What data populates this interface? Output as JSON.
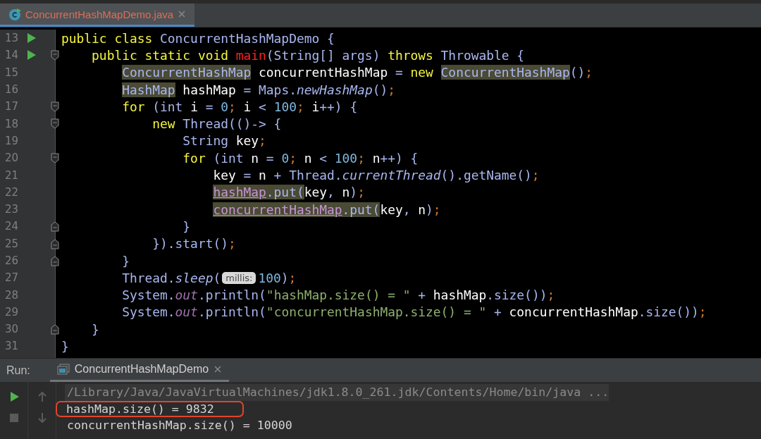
{
  "editor_tab": {
    "label": "ConcurrentHashMapDemo.java",
    "selected": true
  },
  "code_lines": [
    {
      "number": "13",
      "run": true,
      "fold_start": false,
      "fold_end": false,
      "tokens": [
        {
          "text": "public class ",
          "kind": "kw"
        },
        {
          "text": "ConcurrentHashMapDemo {",
          "kind": "sym"
        }
      ]
    },
    {
      "number": "14",
      "run": true,
      "fold_start": true,
      "fold_end": false,
      "tokens": [
        {
          "text": "    public static void ",
          "kind": "kw"
        },
        {
          "text": "main",
          "kind": "decl"
        },
        {
          "text": "(String[] args) ",
          "kind": "sym"
        },
        {
          "text": "throws ",
          "kind": "kw"
        },
        {
          "text": "Throwable {",
          "kind": "sym"
        }
      ]
    },
    {
      "number": "15",
      "run": false,
      "fold_start": false,
      "fold_end": false,
      "tokens": [
        {
          "text": "        ConcurrentHashMap",
          "kind": "hl"
        },
        {
          "text": " concurrentHashMap ",
          "kind": "plain"
        },
        {
          "text": "= ",
          "kind": "sym"
        },
        {
          "text": "new ",
          "kind": "kw"
        },
        {
          "text": "ConcurrentHashMap",
          "kind": "hl"
        },
        {
          "text": "()",
          "kind": "sym"
        },
        {
          "text": ";",
          "kind": "semi"
        }
      ]
    },
    {
      "number": "16",
      "run": false,
      "fold_start": false,
      "fold_end": false,
      "tokens": [
        {
          "text": "        HashMap",
          "kind": "hl"
        },
        {
          "text": " hashMap ",
          "kind": "plain"
        },
        {
          "text": "= Maps.",
          "kind": "sym"
        },
        {
          "text": "newHashMap",
          "kind": "italic"
        },
        {
          "text": "()",
          "kind": "sym"
        },
        {
          "text": ";",
          "kind": "semi"
        }
      ]
    },
    {
      "number": "17",
      "run": false,
      "fold_start": true,
      "fold_end": false,
      "tokens": [
        {
          "text": "        for ",
          "kind": "kw"
        },
        {
          "text": "(int ",
          "kind": "sym"
        },
        {
          "text": "i ",
          "kind": "plain"
        },
        {
          "text": "= ",
          "kind": "sym"
        },
        {
          "text": "0",
          "kind": "num"
        },
        {
          "text": ";",
          "kind": "semi"
        },
        {
          "text": " i ",
          "kind": "plain"
        },
        {
          "text": "< ",
          "kind": "sym"
        },
        {
          "text": "100",
          "kind": "num"
        },
        {
          "text": ";",
          "kind": "semi"
        },
        {
          "text": " i",
          "kind": "plain"
        },
        {
          "text": "++) {",
          "kind": "sym"
        }
      ]
    },
    {
      "number": "18",
      "run": false,
      "fold_start": true,
      "fold_end": false,
      "tokens": [
        {
          "text": "            new ",
          "kind": "kw"
        },
        {
          "text": "Thread(()-> {",
          "kind": "sym"
        }
      ]
    },
    {
      "number": "19",
      "run": false,
      "fold_start": false,
      "fold_end": false,
      "tokens": [
        {
          "text": "                String ",
          "kind": "sym"
        },
        {
          "text": "key",
          "kind": "plain"
        },
        {
          "text": ";",
          "kind": "semi"
        }
      ]
    },
    {
      "number": "20",
      "run": false,
      "fold_start": true,
      "fold_end": false,
      "tokens": [
        {
          "text": "                for ",
          "kind": "kw"
        },
        {
          "text": "(int ",
          "kind": "sym"
        },
        {
          "text": "n ",
          "kind": "plain"
        },
        {
          "text": "= ",
          "kind": "sym"
        },
        {
          "text": "0",
          "kind": "num"
        },
        {
          "text": ";",
          "kind": "semi"
        },
        {
          "text": " n ",
          "kind": "plain"
        },
        {
          "text": "< ",
          "kind": "sym"
        },
        {
          "text": "100",
          "kind": "num"
        },
        {
          "text": ";",
          "kind": "semi"
        },
        {
          "text": " n",
          "kind": "plain"
        },
        {
          "text": "++) {",
          "kind": "sym"
        }
      ]
    },
    {
      "number": "21",
      "run": false,
      "fold_start": false,
      "fold_end": false,
      "tokens": [
        {
          "text": "                    key ",
          "kind": "plain"
        },
        {
          "text": "= ",
          "kind": "sym"
        },
        {
          "text": "n ",
          "kind": "plain"
        },
        {
          "text": "+ Thread.",
          "kind": "sym"
        },
        {
          "text": "currentThread",
          "kind": "italic"
        },
        {
          "text": "().getName()",
          "kind": "sym"
        },
        {
          "text": ";",
          "kind": "semi"
        }
      ]
    },
    {
      "number": "22",
      "run": false,
      "fold_start": false,
      "fold_end": false,
      "tokens": [
        {
          "text": "                    hashMap",
          "kind": "field"
        },
        {
          "text": ".put(",
          "kind": "hlsym"
        },
        {
          "text": "key",
          "kind": "plain"
        },
        {
          "text": ", ",
          "kind": "sym"
        },
        {
          "text": "n",
          "kind": "plain"
        },
        {
          "text": ")",
          "kind": "sym"
        },
        {
          "text": ";",
          "kind": "semi"
        }
      ]
    },
    {
      "number": "23",
      "run": false,
      "fold_start": false,
      "fold_end": false,
      "tokens": [
        {
          "text": "                    concurrentHashMap",
          "kind": "field"
        },
        {
          "text": ".put(",
          "kind": "hlsym"
        },
        {
          "text": "key",
          "kind": "plain"
        },
        {
          "text": ", ",
          "kind": "sym"
        },
        {
          "text": "n",
          "kind": "plain"
        },
        {
          "text": ")",
          "kind": "sym"
        },
        {
          "text": ";",
          "kind": "semi"
        }
      ]
    },
    {
      "number": "24",
      "run": false,
      "fold_start": false,
      "fold_end": true,
      "tokens": [
        {
          "text": "                }",
          "kind": "sym"
        }
      ]
    },
    {
      "number": "25",
      "run": false,
      "fold_start": false,
      "fold_end": true,
      "tokens": [
        {
          "text": "            }).start()",
          "kind": "sym"
        },
        {
          "text": ";",
          "kind": "semi"
        }
      ]
    },
    {
      "number": "26",
      "run": false,
      "fold_start": false,
      "fold_end": true,
      "tokens": [
        {
          "text": "        }",
          "kind": "sym"
        }
      ]
    },
    {
      "number": "27",
      "run": false,
      "fold_start": false,
      "fold_end": false,
      "tokens": [
        {
          "text": "        Thread.",
          "kind": "sym"
        },
        {
          "text": "sleep",
          "kind": "italic"
        },
        {
          "text": "(",
          "kind": "sym"
        },
        {
          "text": "millis:",
          "kind": "hint"
        },
        {
          "text": "100",
          "kind": "num"
        },
        {
          "text": ")",
          "kind": "sym"
        },
        {
          "text": ";",
          "kind": "semi"
        }
      ]
    },
    {
      "number": "28",
      "run": false,
      "fold_start": false,
      "fold_end": false,
      "tokens": [
        {
          "text": "        System.",
          "kind": "sym"
        },
        {
          "text": "out",
          "kind": "static"
        },
        {
          "text": ".println(",
          "kind": "sym"
        },
        {
          "text": "\"hashMap.size() = \"",
          "kind": "str"
        },
        {
          "text": " + ",
          "kind": "sym"
        },
        {
          "text": "hashMap",
          "kind": "plain"
        },
        {
          "text": ".size())",
          "kind": "sym"
        },
        {
          "text": ";",
          "kind": "semi"
        }
      ]
    },
    {
      "number": "29",
      "run": false,
      "fold_start": false,
      "fold_end": false,
      "tokens": [
        {
          "text": "        System.",
          "kind": "sym"
        },
        {
          "text": "out",
          "kind": "static"
        },
        {
          "text": ".println(",
          "kind": "sym"
        },
        {
          "text": "\"concurrentHashMap.size() = \"",
          "kind": "str"
        },
        {
          "text": " + ",
          "kind": "sym"
        },
        {
          "text": "concurrentHashMap",
          "kind": "plain"
        },
        {
          "text": ".size())",
          "kind": "sym"
        },
        {
          "text": ";",
          "kind": "semi"
        }
      ]
    },
    {
      "number": "30",
      "run": false,
      "fold_start": false,
      "fold_end": true,
      "tokens": [
        {
          "text": "    }",
          "kind": "sym"
        }
      ]
    },
    {
      "number": "31",
      "run": false,
      "fold_start": false,
      "fold_end": false,
      "tokens": [
        {
          "text": "}",
          "kind": "sym"
        }
      ]
    }
  ],
  "run_panel": {
    "label": "Run:",
    "tab": {
      "label": "ConcurrentHashMapDemo",
      "selected": true
    },
    "console_lines": [
      {
        "text": "/Library/Java/JavaVirtualMachines/jdk1.8.0_261.jdk/Contents/Home/bin/java ...",
        "kind": "command",
        "marked": false
      },
      {
        "text": "hashMap.size() = 9832",
        "kind": "output",
        "marked": true
      },
      {
        "text": "concurrentHashMap.size() = 10000",
        "kind": "output",
        "marked": false
      }
    ]
  }
}
